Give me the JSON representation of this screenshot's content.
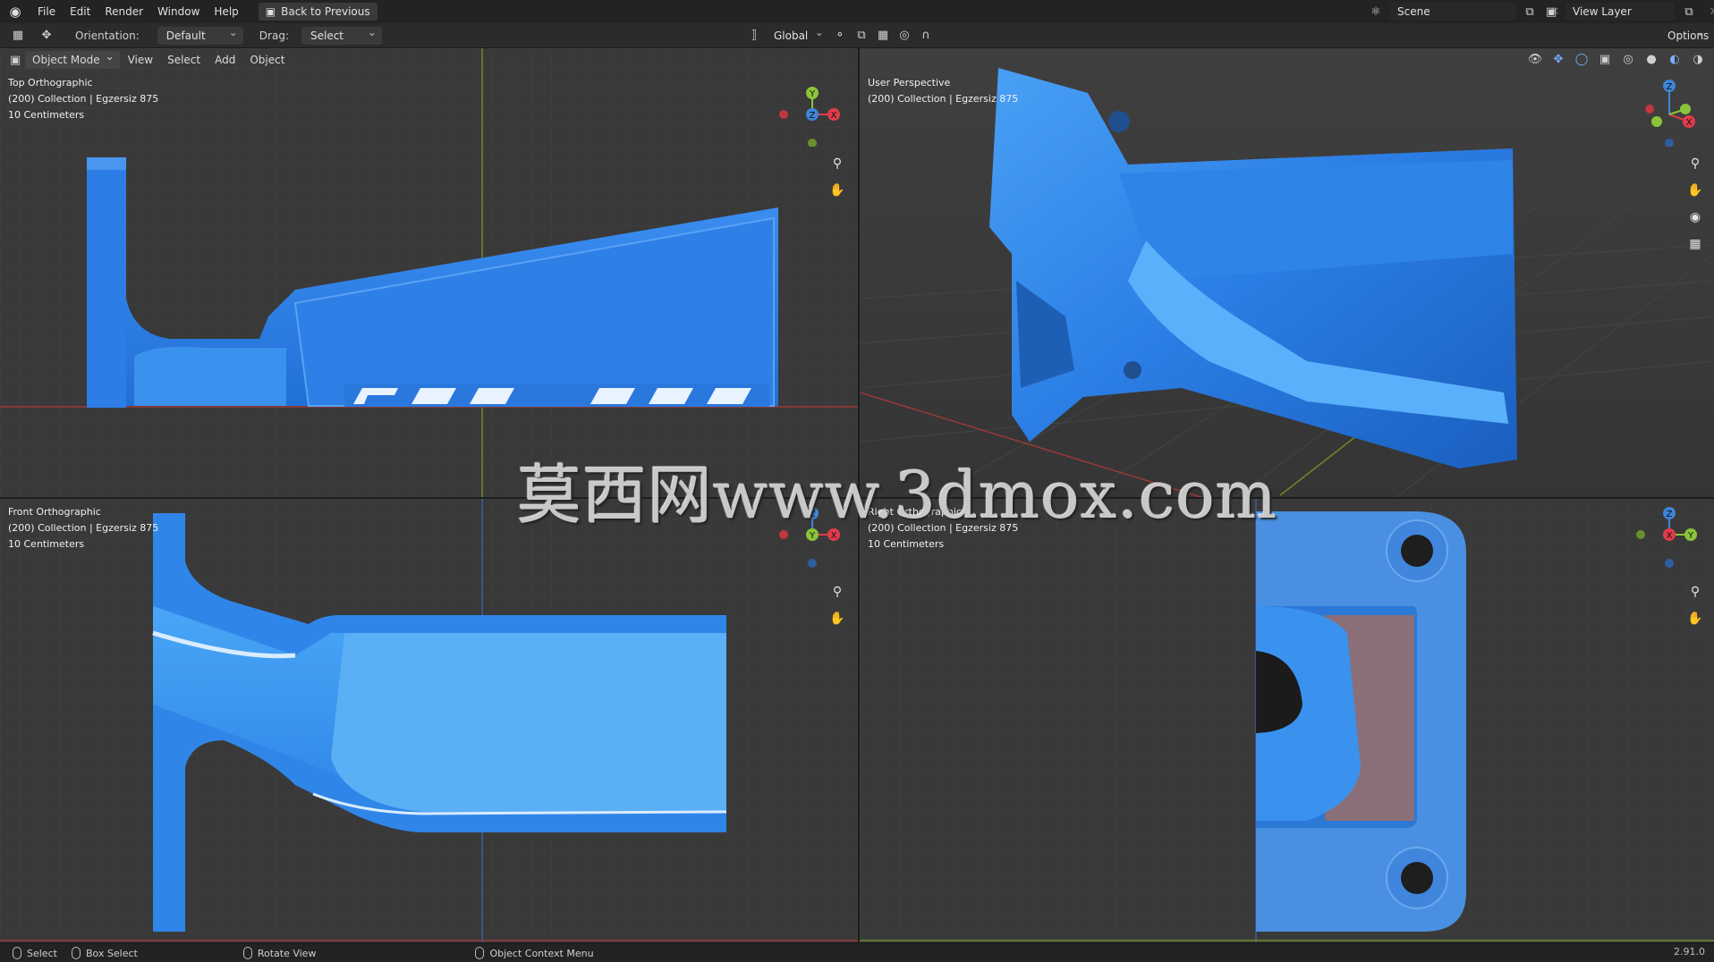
{
  "menubar": {
    "items": [
      "File",
      "Edit",
      "Render",
      "Window",
      "Help"
    ],
    "back_label": "Back to Previous",
    "scene_label": "Scene",
    "view_layer_label": "View Layer"
  },
  "toolheader": {
    "orientation_label": "Orientation:",
    "orientation_value": "Default",
    "drag_label": "Drag:",
    "drag_value": "Select Box",
    "transform_space": "Global",
    "options_label": "Options"
  },
  "viewport_header": {
    "mode": "Object Mode",
    "menus": [
      "View",
      "Select",
      "Add",
      "Object"
    ]
  },
  "viewports": {
    "top": {
      "view": "Top Orthographic",
      "collection": "(200) Collection | Egzersiz 875",
      "scale": "10 Centimeters"
    },
    "persp": {
      "view": "User Perspective",
      "collection": "(200) Collection | Egzersiz 875"
    },
    "front": {
      "view": "Front Orthographic",
      "collection": "(200) Collection | Egzersiz 875",
      "scale": "10 Centimeters"
    },
    "right": {
      "view": "Right Orthographic",
      "collection": "(200) Collection | Egzersiz 875",
      "scale": "10 Centimeters"
    }
  },
  "statusbar": {
    "select": "Select",
    "box_select": "Box Select",
    "rotate": "Rotate View",
    "context": "Object Context Menu",
    "version": "2.91.0"
  },
  "watermark": "莫西网www.3dmox.com",
  "colors": {
    "model_blue": "#2f7fe0",
    "axis_x": "#e03c4b",
    "axis_y": "#8bc43a",
    "axis_z": "#3d85d8"
  }
}
